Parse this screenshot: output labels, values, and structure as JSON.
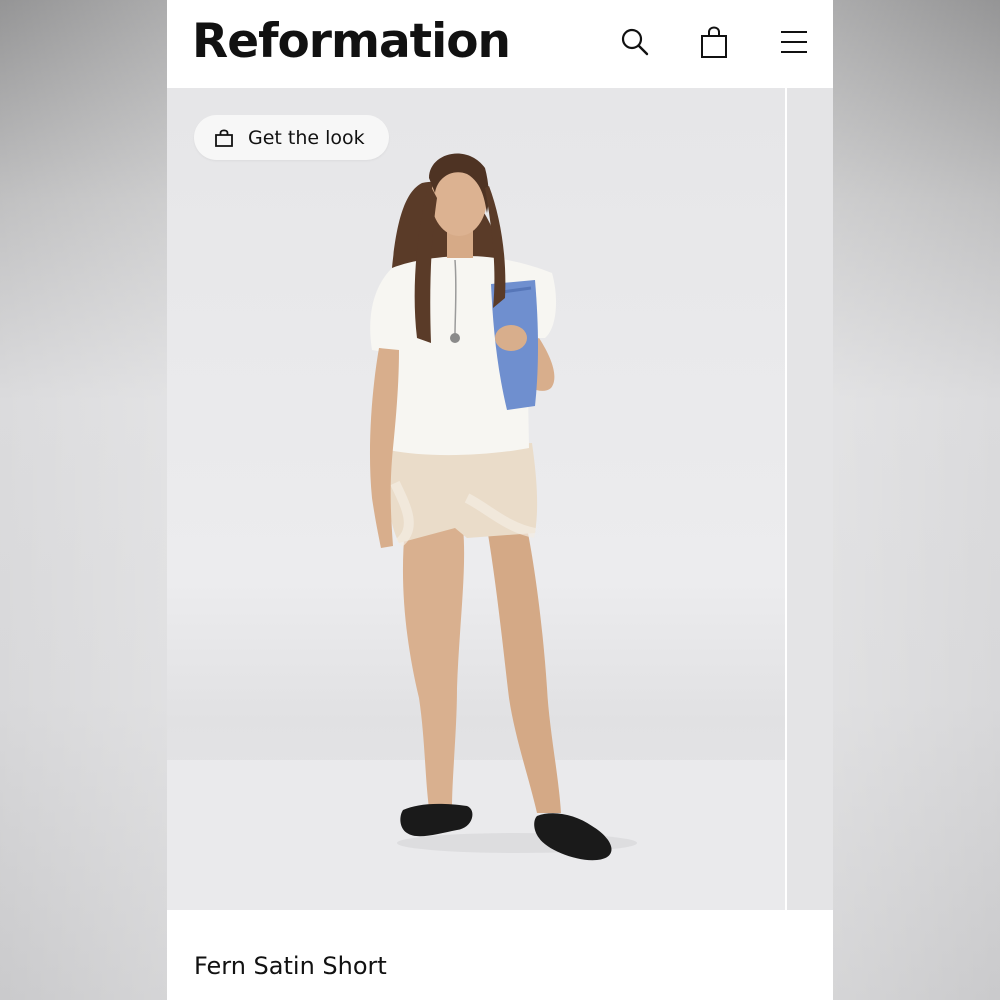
{
  "header": {
    "brand": "Reformation",
    "icons": [
      "search-icon",
      "shopping-bag-icon",
      "hamburger-menu-icon"
    ]
  },
  "hero": {
    "get_the_look_label": "Get the look",
    "get_the_look_icon": "shopping-bag-icon"
  },
  "product": {
    "title": "Fern Satin Short"
  },
  "colors": {
    "background": "#ffffff",
    "text": "#111111",
    "photo_backdrop": "#e8e8ea"
  }
}
